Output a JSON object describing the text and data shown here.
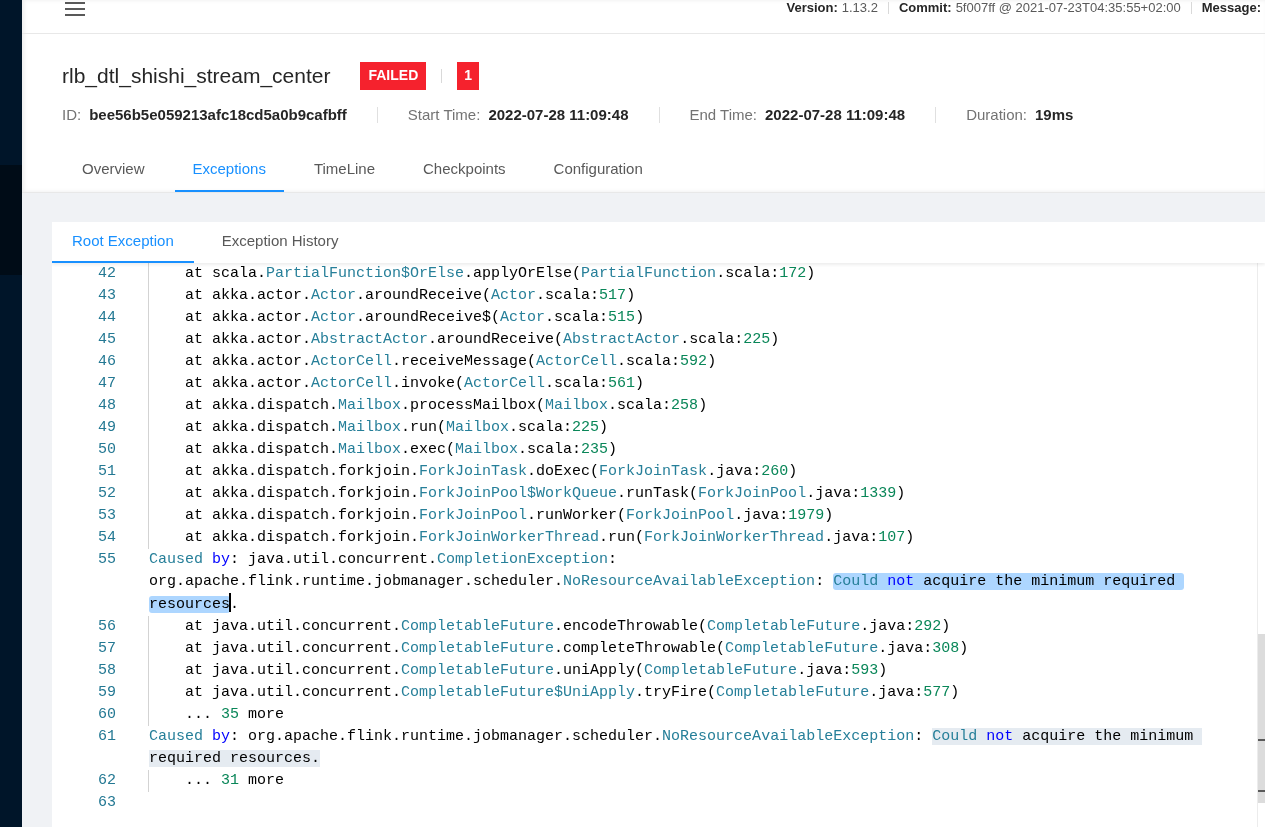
{
  "top_bar": {
    "items": [
      {
        "label": "Version:",
        "value": "1.13.2"
      },
      {
        "label": "Commit:",
        "value": "5f007ff @ 2021-07-23T04:35:55+02:00"
      },
      {
        "label": "Message:"
      }
    ]
  },
  "job": {
    "name": "rlb_dtl_shishi_stream_center",
    "status": "FAILED",
    "count": "1"
  },
  "details": [
    {
      "label": "ID:",
      "value": "bee56b5e059213afc18cd5a0b9cafbff"
    },
    {
      "label": "Start Time:",
      "value": "2022-07-28 11:09:48"
    },
    {
      "label": "End Time:",
      "value": "2022-07-28 11:09:48"
    },
    {
      "label": "Duration:",
      "value": "19ms"
    }
  ],
  "tabs": [
    {
      "label": "Overview",
      "selected": false
    },
    {
      "label": "Exceptions",
      "selected": true
    },
    {
      "label": "TimeLine",
      "selected": false
    },
    {
      "label": "Checkpoints",
      "selected": false
    },
    {
      "label": "Configuration",
      "selected": false
    }
  ],
  "exception_tabs": [
    {
      "label": "Root Exception",
      "selected": true
    },
    {
      "label": "Exception History",
      "selected": false
    }
  ],
  "editor": {
    "lines": [
      {
        "number": "42",
        "kind": "frame",
        "tokens": [
          {
            "text": "at scala.",
            "kind": "plain"
          },
          {
            "text": "PartialFunction$OrElse",
            "kind": "type"
          },
          {
            "text": ".applyOrElse(",
            "kind": "plain"
          },
          {
            "text": "PartialFunction",
            "kind": "type"
          },
          {
            "text": ".scala:",
            "kind": "plain"
          },
          {
            "text": "172",
            "kind": "number"
          },
          {
            "text": ")",
            "kind": "plain"
          }
        ]
      },
      {
        "number": "43",
        "kind": "frame",
        "tokens": [
          {
            "text": "at akka.actor.",
            "kind": "plain"
          },
          {
            "text": "Actor",
            "kind": "type"
          },
          {
            "text": ".aroundReceive(",
            "kind": "plain"
          },
          {
            "text": "Actor",
            "kind": "type"
          },
          {
            "text": ".scala:",
            "kind": "plain"
          },
          {
            "text": "517",
            "kind": "number"
          },
          {
            "text": ")",
            "kind": "plain"
          }
        ]
      },
      {
        "number": "44",
        "kind": "frame",
        "tokens": [
          {
            "text": "at akka.actor.",
            "kind": "plain"
          },
          {
            "text": "Actor",
            "kind": "type"
          },
          {
            "text": ".aroundReceive$(",
            "kind": "plain"
          },
          {
            "text": "Actor",
            "kind": "type"
          },
          {
            "text": ".scala:",
            "kind": "plain"
          },
          {
            "text": "515",
            "kind": "number"
          },
          {
            "text": ")",
            "kind": "plain"
          }
        ]
      },
      {
        "number": "45",
        "kind": "frame",
        "tokens": [
          {
            "text": "at akka.actor.",
            "kind": "plain"
          },
          {
            "text": "AbstractActor",
            "kind": "type"
          },
          {
            "text": ".aroundReceive(",
            "kind": "plain"
          },
          {
            "text": "AbstractActor",
            "kind": "type"
          },
          {
            "text": ".scala:",
            "kind": "plain"
          },
          {
            "text": "225",
            "kind": "number"
          },
          {
            "text": ")",
            "kind": "plain"
          }
        ]
      },
      {
        "number": "46",
        "kind": "frame",
        "tokens": [
          {
            "text": "at akka.actor.",
            "kind": "plain"
          },
          {
            "text": "ActorCell",
            "kind": "type"
          },
          {
            "text": ".receiveMessage(",
            "kind": "plain"
          },
          {
            "text": "ActorCell",
            "kind": "type"
          },
          {
            "text": ".scala:",
            "kind": "plain"
          },
          {
            "text": "592",
            "kind": "number"
          },
          {
            "text": ")",
            "kind": "plain"
          }
        ]
      },
      {
        "number": "47",
        "kind": "frame",
        "tokens": [
          {
            "text": "at akka.actor.",
            "kind": "plain"
          },
          {
            "text": "ActorCell",
            "kind": "type"
          },
          {
            "text": ".invoke(",
            "kind": "plain"
          },
          {
            "text": "ActorCell",
            "kind": "type"
          },
          {
            "text": ".scala:",
            "kind": "plain"
          },
          {
            "text": "561",
            "kind": "number"
          },
          {
            "text": ")",
            "kind": "plain"
          }
        ]
      },
      {
        "number": "48",
        "kind": "frame",
        "tokens": [
          {
            "text": "at akka.dispatch.",
            "kind": "plain"
          },
          {
            "text": "Mailbox",
            "kind": "type"
          },
          {
            "text": ".processMailbox(",
            "kind": "plain"
          },
          {
            "text": "Mailbox",
            "kind": "type"
          },
          {
            "text": ".scala:",
            "kind": "plain"
          },
          {
            "text": "258",
            "kind": "number"
          },
          {
            "text": ")",
            "kind": "plain"
          }
        ]
      },
      {
        "number": "49",
        "kind": "frame",
        "tokens": [
          {
            "text": "at akka.dispatch.",
            "kind": "plain"
          },
          {
            "text": "Mailbox",
            "kind": "type"
          },
          {
            "text": ".run(",
            "kind": "plain"
          },
          {
            "text": "Mailbox",
            "kind": "type"
          },
          {
            "text": ".scala:",
            "kind": "plain"
          },
          {
            "text": "225",
            "kind": "number"
          },
          {
            "text": ")",
            "kind": "plain"
          }
        ]
      },
      {
        "number": "50",
        "kind": "frame",
        "tokens": [
          {
            "text": "at akka.dispatch.",
            "kind": "plain"
          },
          {
            "text": "Mailbox",
            "kind": "type"
          },
          {
            "text": ".exec(",
            "kind": "plain"
          },
          {
            "text": "Mailbox",
            "kind": "type"
          },
          {
            "text": ".scala:",
            "kind": "plain"
          },
          {
            "text": "235",
            "kind": "number"
          },
          {
            "text": ")",
            "kind": "plain"
          }
        ]
      },
      {
        "number": "51",
        "kind": "frame",
        "tokens": [
          {
            "text": "at akka.dispatch.forkjoin.",
            "kind": "plain"
          },
          {
            "text": "ForkJoinTask",
            "kind": "type"
          },
          {
            "text": ".doExec(",
            "kind": "plain"
          },
          {
            "text": "ForkJoinTask",
            "kind": "type"
          },
          {
            "text": ".java:",
            "kind": "plain"
          },
          {
            "text": "260",
            "kind": "number"
          },
          {
            "text": ")",
            "kind": "plain"
          }
        ]
      },
      {
        "number": "52",
        "kind": "frame",
        "tokens": [
          {
            "text": "at akka.dispatch.forkjoin.",
            "kind": "plain"
          },
          {
            "text": "ForkJoinPool$WorkQueue",
            "kind": "type"
          },
          {
            "text": ".runTask(",
            "kind": "plain"
          },
          {
            "text": "ForkJoinPool",
            "kind": "type"
          },
          {
            "text": ".java:",
            "kind": "plain"
          },
          {
            "text": "1339",
            "kind": "number"
          },
          {
            "text": ")",
            "kind": "plain"
          }
        ]
      },
      {
        "number": "53",
        "kind": "frame",
        "tokens": [
          {
            "text": "at akka.dispatch.forkjoin.",
            "kind": "plain"
          },
          {
            "text": "ForkJoinPool",
            "kind": "type"
          },
          {
            "text": ".runWorker(",
            "kind": "plain"
          },
          {
            "text": "ForkJoinPool",
            "kind": "type"
          },
          {
            "text": ".java:",
            "kind": "plain"
          },
          {
            "text": "1979",
            "kind": "number"
          },
          {
            "text": ")",
            "kind": "plain"
          }
        ]
      },
      {
        "number": "54",
        "kind": "frame",
        "tokens": [
          {
            "text": "at akka.dispatch.forkjoin.",
            "kind": "plain"
          },
          {
            "text": "ForkJoinWorkerThread",
            "kind": "type"
          },
          {
            "text": ".run(",
            "kind": "plain"
          },
          {
            "text": "ForkJoinWorkerThread",
            "kind": "type"
          },
          {
            "text": ".java:",
            "kind": "plain"
          },
          {
            "text": "107",
            "kind": "number"
          },
          {
            "text": ")",
            "kind": "plain"
          }
        ]
      },
      {
        "number": "55",
        "kind": "cause",
        "active": true,
        "segments": [
          {
            "highlighted": false,
            "cursor": false,
            "tokens": [
              {
                "text": "Caused",
                "kind": "type"
              },
              {
                "text": " by",
                "kind": "keyword"
              },
              {
                "text": ": java.util.concurrent.",
                "kind": "plain"
              },
              {
                "text": "CompletionException",
                "kind": "type"
              },
              {
                "text": ": org.apache.flink.runtime.jobmanager.scheduler.",
                "kind": "plain"
              },
              {
                "text": "NoResourceAvailableException",
                "kind": "type"
              },
              {
                "text": ": ",
                "kind": "plain"
              }
            ]
          },
          {
            "highlighted": true,
            "cursor": false,
            "tokens": [
              {
                "text": "Could",
                "kind": "type"
              },
              {
                "text": " not",
                "kind": "keyword"
              },
              {
                "text": " acquire the minimum required ",
                "kind": "plain"
              }
            ]
          },
          {
            "highlighted": true,
            "cursor": true,
            "tokens": [
              {
                "text": "resources",
                "kind": "plain"
              }
            ]
          },
          {
            "highlighted": false,
            "cursor": false,
            "tokens": [
              {
                "text": ".",
                "kind": "plain"
              }
            ]
          }
        ]
      },
      {
        "number": "56",
        "kind": "frame",
        "tokens": [
          {
            "text": "at java.util.concurrent.",
            "kind": "plain"
          },
          {
            "text": "CompletableFuture",
            "kind": "type"
          },
          {
            "text": ".encodeThrowable(",
            "kind": "plain"
          },
          {
            "text": "CompletableFuture",
            "kind": "type"
          },
          {
            "text": ".java:",
            "kind": "plain"
          },
          {
            "text": "292",
            "kind": "number"
          },
          {
            "text": ")",
            "kind": "plain"
          }
        ]
      },
      {
        "number": "57",
        "kind": "frame",
        "tokens": [
          {
            "text": "at java.util.concurrent.",
            "kind": "plain"
          },
          {
            "text": "CompletableFuture",
            "kind": "type"
          },
          {
            "text": ".completeThrowable(",
            "kind": "plain"
          },
          {
            "text": "CompletableFuture",
            "kind": "type"
          },
          {
            "text": ".java:",
            "kind": "plain"
          },
          {
            "text": "308",
            "kind": "number"
          },
          {
            "text": ")",
            "kind": "plain"
          }
        ]
      },
      {
        "number": "58",
        "kind": "frame",
        "tokens": [
          {
            "text": "at java.util.concurrent.",
            "kind": "plain"
          },
          {
            "text": "CompletableFuture",
            "kind": "type"
          },
          {
            "text": ".uniApply(",
            "kind": "plain"
          },
          {
            "text": "CompletableFuture",
            "kind": "type"
          },
          {
            "text": ".java:",
            "kind": "plain"
          },
          {
            "text": "593",
            "kind": "number"
          },
          {
            "text": ")",
            "kind": "plain"
          }
        ]
      },
      {
        "number": "59",
        "kind": "frame",
        "tokens": [
          {
            "text": "at java.util.concurrent.",
            "kind": "plain"
          },
          {
            "text": "CompletableFuture$UniApply",
            "kind": "type"
          },
          {
            "text": ".tryFire(",
            "kind": "plain"
          },
          {
            "text": "CompletableFuture",
            "kind": "type"
          },
          {
            "text": ".java:",
            "kind": "plain"
          },
          {
            "text": "577",
            "kind": "number"
          },
          {
            "text": ")",
            "kind": "plain"
          }
        ]
      },
      {
        "number": "60",
        "kind": "frame",
        "tokens": [
          {
            "text": "... ",
            "kind": "plain"
          },
          {
            "text": "35",
            "kind": "number"
          },
          {
            "text": " more",
            "kind": "plain"
          }
        ]
      },
      {
        "number": "61",
        "kind": "cause",
        "active": false,
        "segments": [
          {
            "highlighted": false,
            "cursor": false,
            "tokens": [
              {
                "text": "Caused",
                "kind": "type"
              },
              {
                "text": " by",
                "kind": "keyword"
              },
              {
                "text": ": org.apache.flink.runtime.jobmanager.scheduler.",
                "kind": "plain"
              },
              {
                "text": "NoResourceAvailableException",
                "kind": "type"
              },
              {
                "text": ": ",
                "kind": "plain"
              }
            ]
          },
          {
            "highlighted": true,
            "cursor": false,
            "tokens": [
              {
                "text": "Could",
                "kind": "type"
              },
              {
                "text": " not",
                "kind": "keyword"
              },
              {
                "text": " acquire the minimum ",
                "kind": "plain"
              }
            ]
          },
          {
            "highlighted": true,
            "cursor": false,
            "tokens": [
              {
                "text": "required resources.",
                "kind": "plain"
              }
            ]
          }
        ]
      },
      {
        "number": "62",
        "kind": "frame",
        "tokens": [
          {
            "text": "... ",
            "kind": "plain"
          },
          {
            "text": "31",
            "kind": "number"
          },
          {
            "text": " more",
            "kind": "plain"
          }
        ]
      },
      {
        "number": "63",
        "kind": "blank"
      }
    ]
  }
}
